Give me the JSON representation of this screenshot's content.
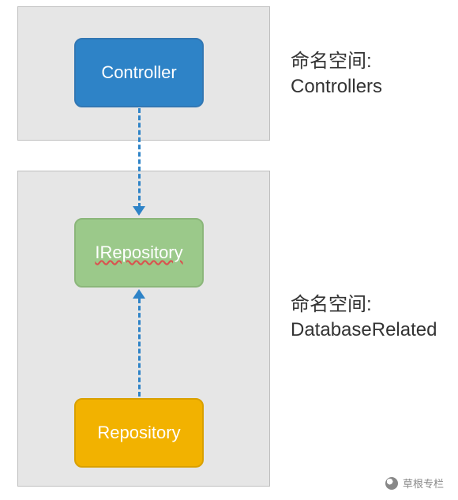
{
  "chart_data": {
    "type": "diagram",
    "nodes": [
      {
        "id": "controller",
        "label": "Controller",
        "namespace": "Controllers",
        "fill": "#2e83c7",
        "shape": "rounded-rect"
      },
      {
        "id": "irepository",
        "label": "IRepository",
        "namespace": "DatabaseRelated",
        "fill": "#9bc98a",
        "shape": "rounded-rect",
        "underlineWavy": true
      },
      {
        "id": "repository",
        "label": "Repository",
        "namespace": "DatabaseRelated",
        "fill": "#f2b200",
        "shape": "rounded-rect"
      }
    ],
    "edges": [
      {
        "from": "controller",
        "to": "irepository",
        "style": "dashed",
        "arrow": "to",
        "color": "#2e83c7"
      },
      {
        "from": "repository",
        "to": "irepository",
        "style": "dashed",
        "arrow": "to",
        "color": "#2e83c7"
      }
    ],
    "namespaces": [
      {
        "id": "Controllers",
        "labelPrefix": "命名空间:",
        "labelName": "Controllers"
      },
      {
        "id": "DatabaseRelated",
        "labelPrefix": "命名空间:",
        "labelName": "DatabaseRelated"
      }
    ]
  },
  "nodes": {
    "controller": "Controller",
    "irepository": "IRepository",
    "repository": "Repository"
  },
  "labels": {
    "ns1_prefix": "命名空间:",
    "ns1_name": "Controllers",
    "ns2_prefix": "命名空间:",
    "ns2_name": "DatabaseRelated"
  },
  "watermark": {
    "text": "草根专栏"
  }
}
